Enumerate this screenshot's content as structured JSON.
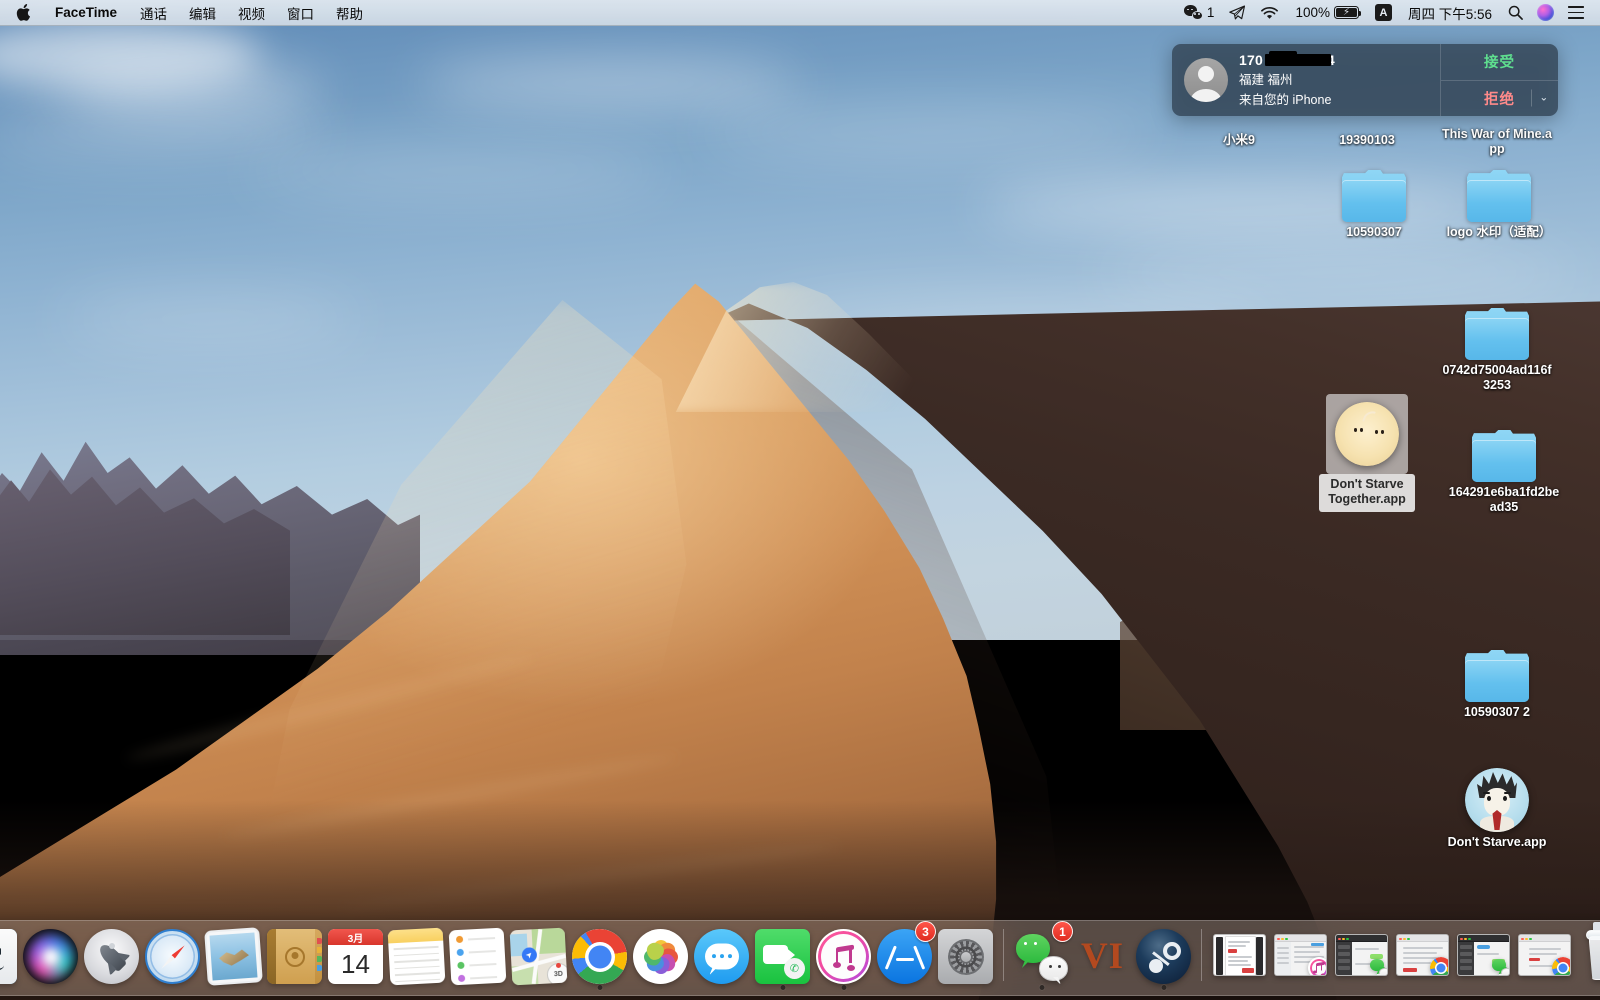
{
  "menubar": {
    "apple_logo": "",
    "app_name": "FaceTime",
    "items": [
      "通话",
      "编辑",
      "视频",
      "窗口",
      "帮助"
    ],
    "status": {
      "wechat_count": "1",
      "battery_percent": "100%",
      "battery_bolt": "⚡",
      "input_source": "A",
      "datetime": "周四 下午5:56"
    }
  },
  "notification": {
    "caller_number": "170",
    "caller_number_suffix": "04",
    "location": "福建 福州",
    "source": "来自您的 iPhone",
    "accept_label": "接受",
    "decline_label": "拒绝",
    "chevron": "⌄",
    "accept_color": "#5fe08f",
    "decline_color": "#ff8a8a"
  },
  "desktop_icons": [
    {
      "label": "小米9",
      "type": "disk"
    },
    {
      "label": "19390103",
      "type": "folder"
    },
    {
      "label": "This War of Mine.app",
      "type": "app"
    },
    {
      "label": "10590307",
      "type": "folder"
    },
    {
      "label": "logo 水印（适配）",
      "type": "folder"
    },
    {
      "label": "0742d75004ad116f3253",
      "type": "folder"
    },
    {
      "label": "164291e6ba1fd2bead35",
      "type": "folder"
    },
    {
      "label": "10590307 2",
      "type": "folder"
    },
    {
      "label": "Don't Starve.app",
      "type": "app"
    }
  ],
  "dragged_icon": {
    "label": "Don't Starve Together.app",
    "state": "selected"
  },
  "dock": {
    "apps": [
      {
        "name": "Finder",
        "running": true
      },
      {
        "name": "Siri",
        "running": false
      },
      {
        "name": "Launchpad",
        "running": false
      },
      {
        "name": "Safari",
        "running": false
      },
      {
        "name": "Mail",
        "running": false
      },
      {
        "name": "Contacts",
        "running": false
      },
      {
        "name": "Calendar",
        "running": false,
        "month": "3月",
        "day": "14"
      },
      {
        "name": "Notes",
        "running": false
      },
      {
        "name": "Reminders",
        "running": false
      },
      {
        "name": "Maps",
        "running": false
      },
      {
        "name": "Google Chrome",
        "running": true
      },
      {
        "name": "Photos",
        "running": false
      },
      {
        "name": "Messages",
        "running": false
      },
      {
        "name": "FaceTime",
        "running": true
      },
      {
        "name": "iTunes",
        "running": true
      },
      {
        "name": "App Store",
        "running": false,
        "badge": "3"
      },
      {
        "name": "System Preferences",
        "running": false
      },
      {
        "name": "WeChat",
        "running": true,
        "badge": "1"
      },
      {
        "name": "MacVim",
        "running": false,
        "glyph": "VI"
      },
      {
        "name": "Steam",
        "running": true
      }
    ],
    "minimized_windows": [
      {
        "name": "document-window",
        "app_badge": "none"
      },
      {
        "name": "itunes-window",
        "app_badge": "itunes"
      },
      {
        "name": "wechat-window",
        "app_badge": "wechat"
      },
      {
        "name": "chrome-window",
        "app_badge": "chrome"
      },
      {
        "name": "wechat-window-2",
        "app_badge": "wechat"
      },
      {
        "name": "chrome-window-2",
        "app_badge": "chrome"
      }
    ],
    "trash": {
      "name": "Trash",
      "full": true
    }
  },
  "colors": {
    "accent_blue": "#3478f6",
    "badge_red": "#e02b1f",
    "folder_blue": "#6cc4ef",
    "menubar_bg": "#d1dbe5"
  }
}
